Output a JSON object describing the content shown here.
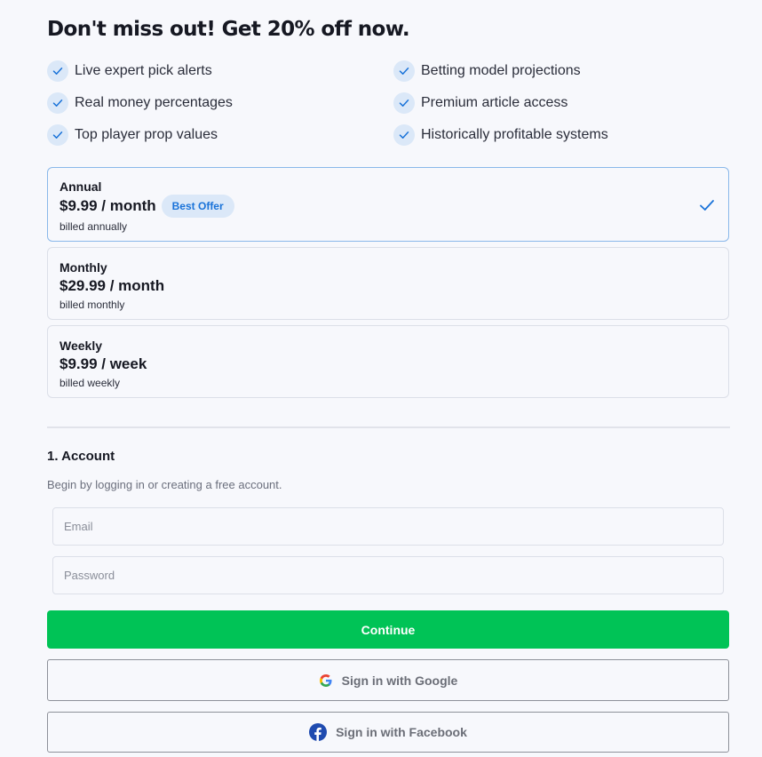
{
  "headline": "Don't miss out! Get 20% off now.",
  "features": [
    "Live expert pick alerts",
    "Betting model projections",
    "Real money percentages",
    "Premium article access",
    "Top player prop values",
    "Historically profitable systems"
  ],
  "plans": [
    {
      "name": "Annual",
      "price": "$9.99 / month",
      "badge": "Best Offer",
      "billing": "billed annually",
      "selected": true
    },
    {
      "name": "Monthly",
      "price": "$29.99 / month",
      "billing": "billed monthly",
      "selected": false
    },
    {
      "name": "Weekly",
      "price": "$9.99 / week",
      "billing": "billed weekly",
      "selected": false
    }
  ],
  "account": {
    "title": "1. Account",
    "subtitle": "Begin by logging in or creating a free account.",
    "email_placeholder": "Email",
    "password_placeholder": "Password",
    "continue_label": "Continue",
    "google_label": "Sign in with Google",
    "facebook_label": "Sign in with Facebook"
  },
  "colors": {
    "accent_blue": "#1a73d9",
    "continue_green": "#00c356",
    "badge_bg": "#dbe8f8"
  }
}
